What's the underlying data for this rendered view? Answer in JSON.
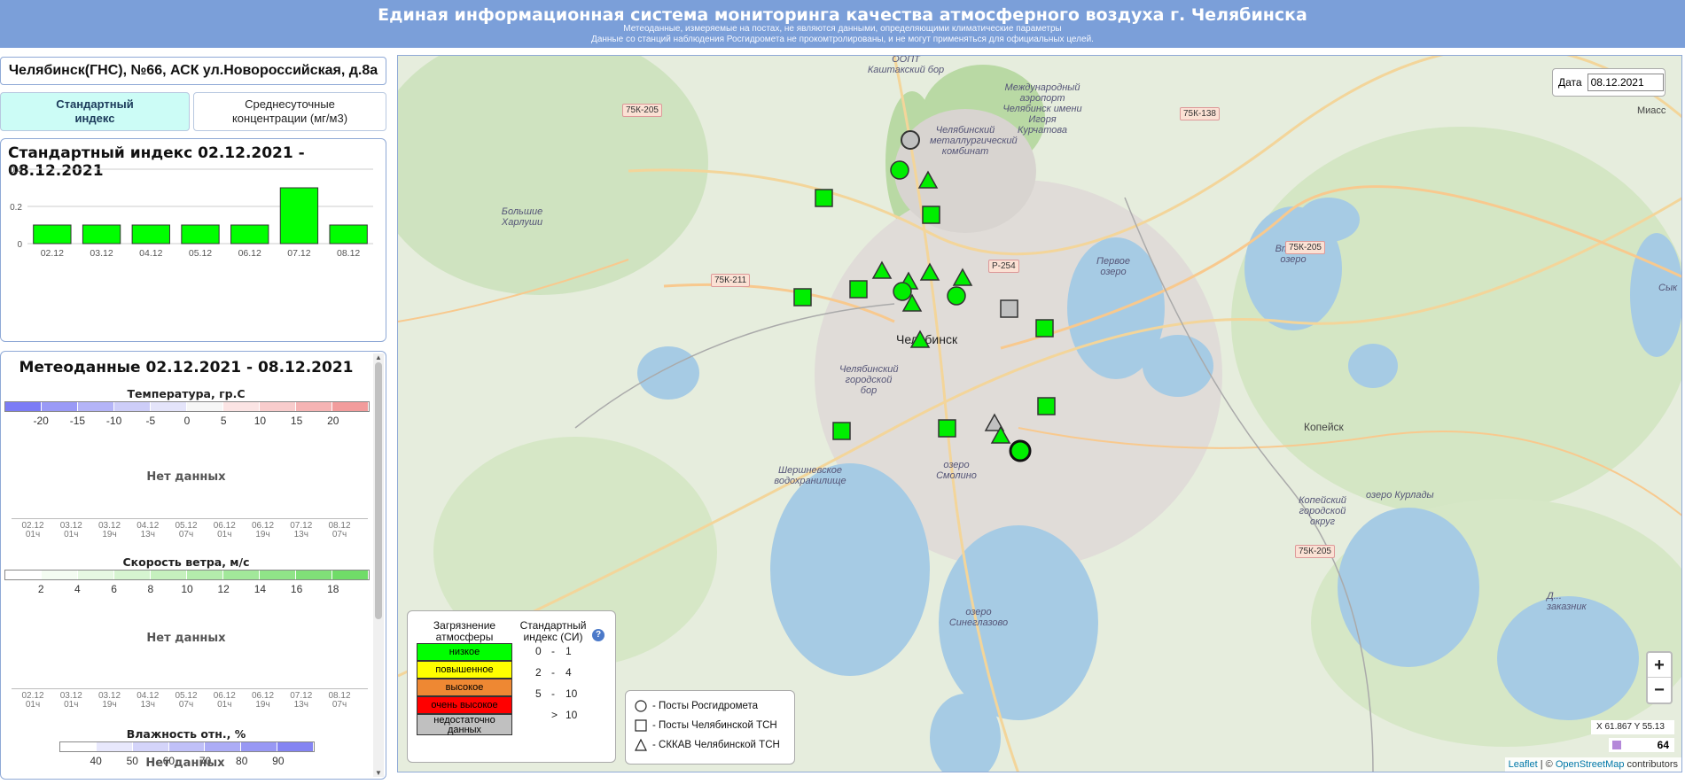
{
  "header": {
    "title": "Единая информационная система мониторинга качества атмосферного воздуха г. Челябинска",
    "subtitle1": "Метеоданные, измеряемые на постах, не являются данными, определяющими климатические параметры",
    "subtitle2": "Данные со станций наблюдения Росгидромета не прокомтролированы, и не могут применяться для официальных целей."
  },
  "station": {
    "name": "Челябинск(ГНС), №66, АСК ул.Новороссийская, д.8а"
  },
  "tabs": {
    "index_label": "Стандартный индекс",
    "conc_label": "Среднесуточные концентрации (мг/м3)"
  },
  "index_chart": {
    "title": "Стандартный индекс 02.12.2021 - 08.12.2021",
    "chart_data": {
      "type": "bar",
      "categories": [
        "02.12",
        "03.12",
        "04.12",
        "05.12",
        "06.12",
        "07.12",
        "08.12"
      ],
      "values": [
        0.1,
        0.1,
        0.1,
        0.1,
        0.1,
        0.3,
        0.1
      ],
      "ylim": [
        0,
        0.4
      ],
      "yticks": [
        "0",
        "0.2",
        "0.4"
      ],
      "bar_color": "#00ff00"
    }
  },
  "meteo": {
    "title": "Метеоданные 02.12.2021 - 08.12.2021",
    "temp_title": "Температура, гр.С",
    "temp_labels": [
      "-20",
      "-15",
      "-10",
      "-5",
      "0",
      "5",
      "10",
      "15",
      "20"
    ],
    "wind_title": "Скорость ветра, м/с",
    "wind_labels": [
      "2",
      "4",
      "6",
      "8",
      "10",
      "12",
      "14",
      "16",
      "18"
    ],
    "hum_title": "Влажность отн., %",
    "hum_labels": [
      "40",
      "50",
      "60",
      "70",
      "80",
      "90"
    ],
    "no_data": "Нет данных",
    "axis_dates": [
      "02.12",
      "03.12",
      "03.12",
      "04.12",
      "05.12",
      "06.12",
      "06.12",
      "07.12",
      "08.12"
    ],
    "axis_times": [
      "01ч",
      "01ч",
      "19ч",
      "13ч",
      "07ч",
      "01ч",
      "19ч",
      "13ч",
      "07ч"
    ]
  },
  "map": {
    "date_label": "Дата",
    "date_value": "08.12.2021",
    "city_name": "Челябинск",
    "kopeysk": "Копейск",
    "labels": {
      "oopt": "ООПТ Каштакский бор",
      "airport": "Международный аэропорт Челябинск имени Игоря Курчатова",
      "metcomb": "Челябинский металлургический комбинат",
      "khar": "Большие Харлуши",
      "bor": "Челябинский городской бор",
      "shersh": "Шершневское водохранилище",
      "smol": "озеро Смолино",
      "first": "Первое озеро",
      "second": "Второе озеро",
      "kurlady": "озеро Курлады",
      "sineg": "озеро Синеглазово",
      "kop_okrug": "Копейский городской округ",
      "miass": "Миасс",
      "sykt": "Сык",
      "zakaz": "Д... заказник"
    },
    "roads": [
      "75К-205",
      "75К-138",
      "75К-205",
      "75К-211",
      "Р-254",
      "75К-205"
    ],
    "legend": {
      "h1": "Загрязнение атмосферы",
      "h2": "Стандартный индекс (СИ)",
      "levels": [
        {
          "label": "низкое",
          "color": "#00ff00",
          "r1": "0",
          "r2": "1"
        },
        {
          "label": "повышенное",
          "color": "#ffff00",
          "r1": "2",
          "r2": "4"
        },
        {
          "label": "высокое",
          "color": "#ee8833",
          "r1": "5",
          "r2": "10"
        },
        {
          "label": "очень высокое",
          "color": "#ff0000",
          "r1": "",
          "r2": "10"
        },
        {
          "label": "недостаточно данных",
          "color": "#c0c0c0",
          "r1": "",
          "r2": ""
        }
      ],
      "help": "?"
    },
    "legend2": {
      "roshydromet": "- Посты Росгидромета",
      "tsn": "- Посты Челябинской ТСН",
      "skkav": "- СККАВ Челябинской ТСН"
    },
    "zoom_in": "+",
    "zoom_out": "−",
    "coords": "X  61.867   Y  55.13",
    "zoom_level": "64",
    "attribution_leaflet": "Leaflet",
    "attribution_sep": " | © ",
    "attribution_osm": "OpenStreetMap",
    "attribution_tail": " contributors",
    "markers": {
      "green": "#00ee00",
      "grey": "#c0c0c0"
    }
  }
}
